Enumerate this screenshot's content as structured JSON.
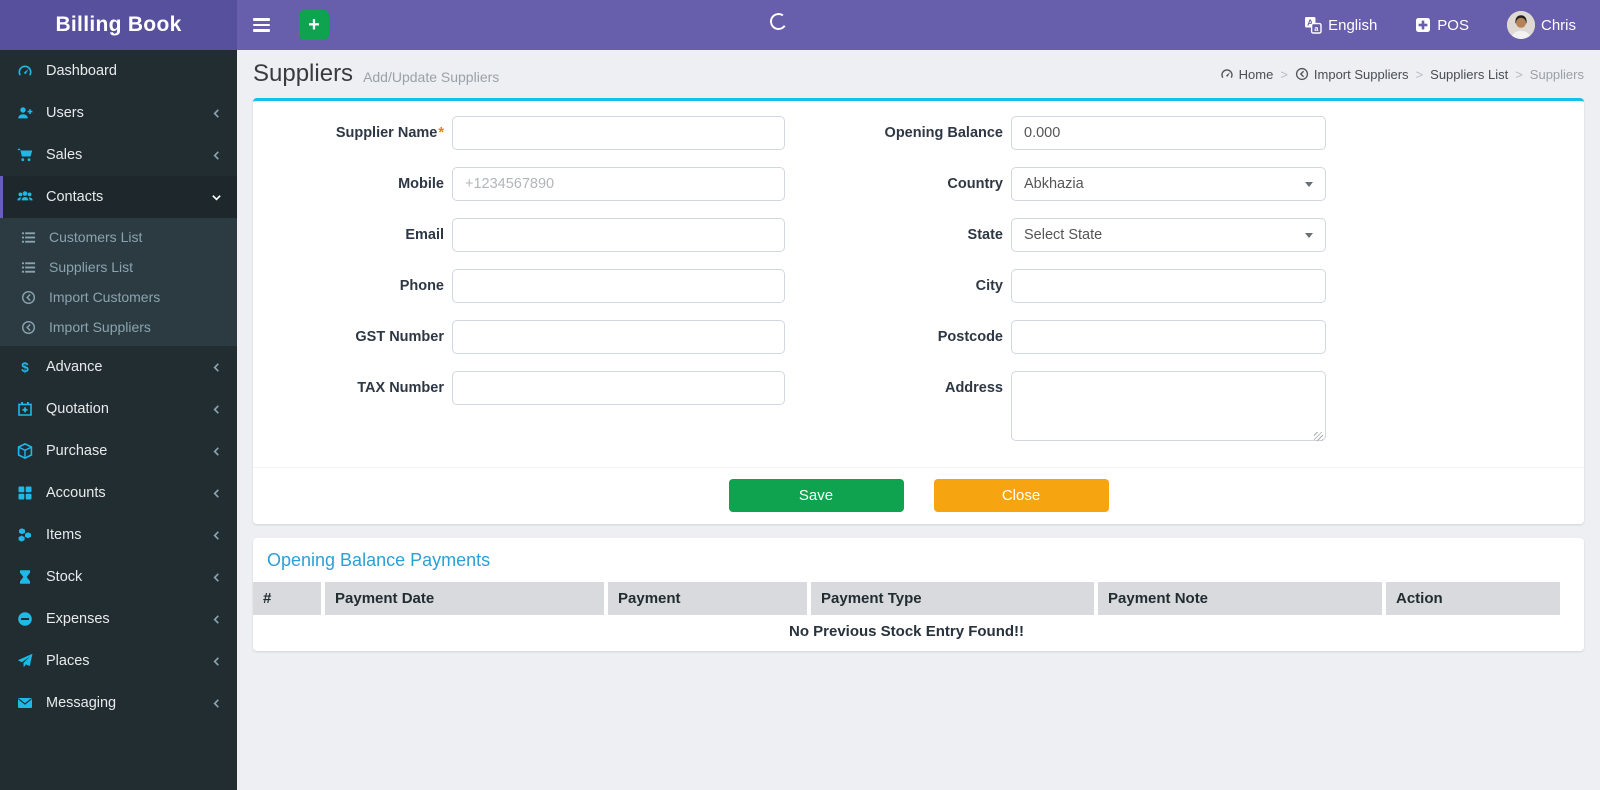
{
  "colors": {
    "navbar_purple": "#675EAC",
    "logo_purple": "#57509D",
    "sidebar_dark": "#222D32",
    "icon_cyan": "#1EB8E9",
    "panel_top_border": "#16C1E9",
    "save_green": "#0FA24F",
    "close_orange": "#F7A411",
    "section_title_blue": "#2E9FD6",
    "active_border_purple": "#6A5FB8"
  },
  "navbar": {
    "brand": "Billing Book",
    "language": "English",
    "pos": "POS",
    "user": "Chris"
  },
  "sidebar": {
    "items": [
      {
        "label": "Dashboard"
      },
      {
        "label": "Users"
      },
      {
        "label": "Sales"
      },
      {
        "label": "Contacts"
      },
      {
        "label": "Advance"
      },
      {
        "label": "Quotation"
      },
      {
        "label": "Purchase"
      },
      {
        "label": "Accounts"
      },
      {
        "label": "Items"
      },
      {
        "label": "Stock"
      },
      {
        "label": "Expenses"
      },
      {
        "label": "Places"
      },
      {
        "label": "Messaging"
      }
    ],
    "contacts_submenu": [
      {
        "label": "Customers List"
      },
      {
        "label": "Suppliers List"
      },
      {
        "label": "Import Customers"
      },
      {
        "label": "Import Suppliers"
      }
    ]
  },
  "page_header": {
    "title": "Suppliers",
    "subtitle": "Add/Update Suppliers",
    "breadcrumb": [
      {
        "label": "Home"
      },
      {
        "label": "Import Suppliers"
      },
      {
        "label": "Suppliers List"
      },
      {
        "label": "Suppliers"
      }
    ]
  },
  "form": {
    "left": [
      {
        "label": "Supplier Name",
        "required": "*",
        "value": "",
        "placeholder": ""
      },
      {
        "label": "Mobile",
        "value": "",
        "placeholder": "+1234567890"
      },
      {
        "label": "Email",
        "value": "",
        "placeholder": ""
      },
      {
        "label": "Phone",
        "value": "",
        "placeholder": ""
      },
      {
        "label": "GST Number",
        "value": "",
        "placeholder": ""
      },
      {
        "label": "TAX Number",
        "value": "",
        "placeholder": ""
      }
    ],
    "right": [
      {
        "label": "Opening Balance",
        "value": "0.000"
      },
      {
        "label": "Country",
        "value": "Abkhazia"
      },
      {
        "label": "State",
        "value": "Select State"
      },
      {
        "label": "City",
        "value": ""
      },
      {
        "label": "Postcode",
        "value": ""
      },
      {
        "label": "Address",
        "value": ""
      }
    ],
    "buttons": {
      "save": "Save",
      "close": "Close"
    }
  },
  "payments": {
    "title": "Opening Balance Payments",
    "columns": [
      "#",
      "Payment Date",
      "Payment",
      "Payment Type",
      "Payment Note",
      "Action"
    ],
    "empty_message": "No Previous Stock Entry Found!!"
  }
}
